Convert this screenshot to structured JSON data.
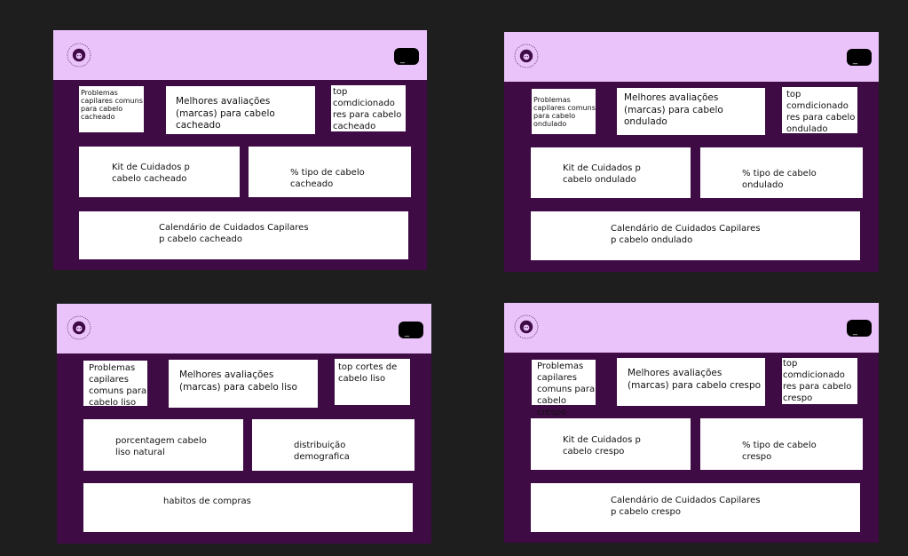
{
  "brand": {
    "logo_ring_text": "CACHOS BRASILEIROS HAIR STYLE",
    "logo_colors": {
      "ring": "#3f0b45",
      "face": "#3f0b45",
      "skin": "#ebc3fb"
    }
  },
  "header": {
    "button_label": "_"
  },
  "colors": {
    "background": "#1e1e1e",
    "frame": "#3f0b45",
    "header": "#ebc3fb",
    "card": "#ffffff"
  },
  "dashboards": [
    {
      "problems": "Problemas\ncapilares comuns\npara cabelo\ncacheado",
      "ratings": "Melhores avaliações\n(marcas) para cabelo\ncacheado",
      "top": "top\ncomdicionado\nres para cabelo\ncacheado",
      "middle_left": "Kit de Cuidados p\ncabelo cacheado",
      "middle_right": "% tipo de cabelo\ncacheado",
      "bottom": "Calendário de Cuidados Capilares\np cabelo cacheado"
    },
    {
      "problems": "Problemas\ncapilares comuns\npara cabelo\nondulado",
      "ratings": "Melhores avaliações\n(marcas) para cabelo\nondulado",
      "top": "top\ncomdicionado\nres para cabelo\nondulado",
      "middle_left": "Kit de Cuidados p\ncabelo ondulado",
      "middle_right": "% tipo de cabelo\nondulado",
      "bottom": "Calendário de Cuidados Capilares\np cabelo ondulado"
    },
    {
      "problems": "Problemas\ncapilares\ncomuns para\ncabelo liso",
      "ratings": "Melhores avaliações\n(marcas) para cabelo liso",
      "top": "top cortes de\ncabelo liso",
      "middle_left": "porcentagem cabelo\nliso natural",
      "middle_right": "distribuição\ndemografica",
      "bottom": "habitos de compras"
    },
    {
      "problems": "Problemas\ncapilares\ncomuns para\ncabelo crespo",
      "ratings": "Melhores avaliações\n(marcas) para cabelo crespo",
      "top": "top\ncomdicionado\nres para cabelo\ncrespo",
      "middle_left": "Kit de Cuidados p\ncabelo crespo",
      "middle_right": "% tipo de cabelo\ncrespo",
      "bottom": "Calendário de Cuidados Capilares\np cabelo crespo"
    }
  ]
}
